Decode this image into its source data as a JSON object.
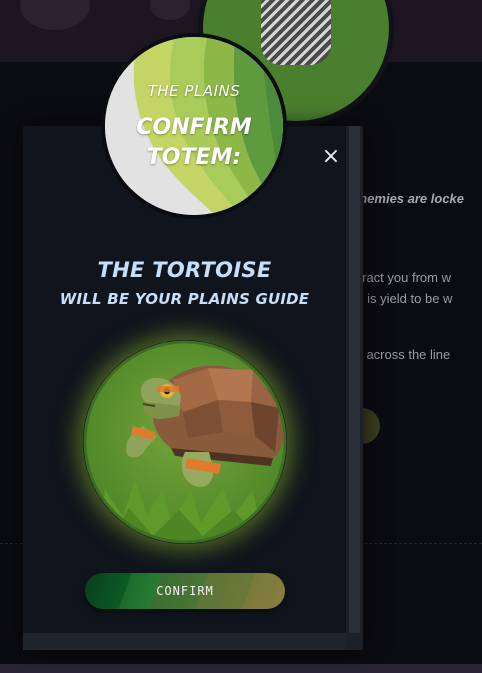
{
  "background": {
    "lines": [
      "enemies are locke",
      "stract you from w",
      "re is yield to be w",
      "m across the line"
    ]
  },
  "badge": {
    "level": "THE PLAINS",
    "line1": "CONFIRM",
    "line2": "TOTEM:"
  },
  "modal": {
    "close_symbol": "×",
    "title": "THE TORTOISE",
    "subtitle": "WILL BE YOUR PLAINS GUIDE",
    "totem_icon": "tortoise-icon",
    "confirm_label": "CONFIRM"
  },
  "colors": {
    "title": "#c5defa",
    "modal_bg": "#10151d",
    "totem_glow": "#87af28",
    "badge_light_green": "#c4d565",
    "badge_mid_green": "#8db848",
    "badge_dark_green": "#4c8a3c"
  }
}
